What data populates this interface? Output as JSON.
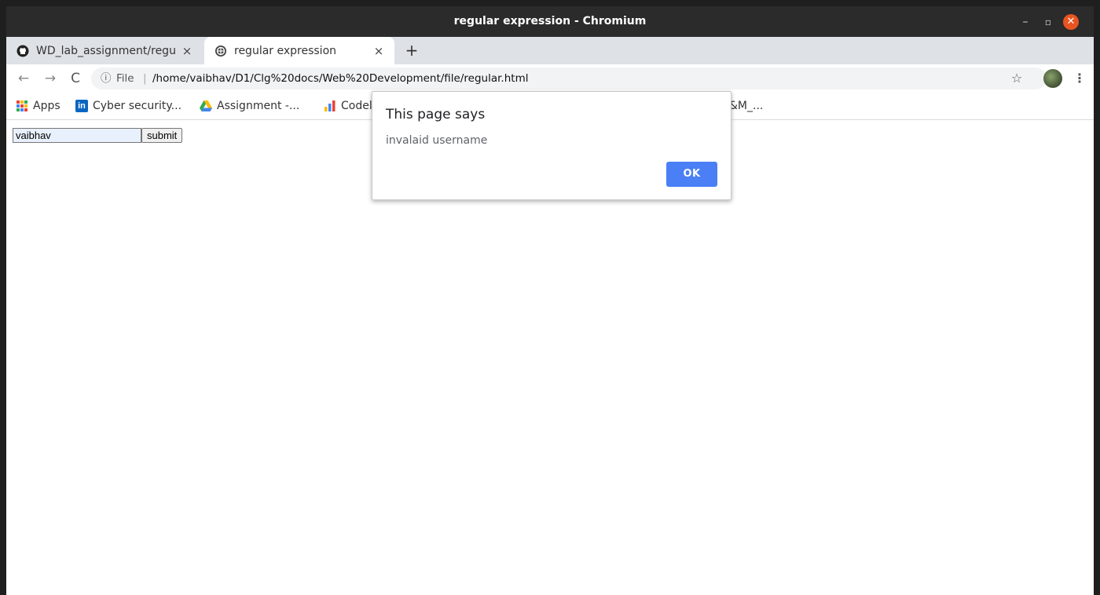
{
  "window": {
    "title": "regular expression - Chromium",
    "controls": {
      "minimize": "–",
      "maximize": "▫",
      "close": "✕"
    }
  },
  "tabs": [
    {
      "label": "WD_lab_assignment/regu",
      "icon": "github-icon",
      "close": "×",
      "active": false
    },
    {
      "label": "regular expression",
      "icon": "globe-icon",
      "close": "×",
      "active": true
    }
  ],
  "new_tab": "+",
  "toolbar": {
    "back": "←",
    "forward": "→",
    "reload": "C",
    "info": "ⓘ",
    "scheme": "File",
    "separator": "|",
    "url": "/home/vaibhav/D1/Clg%20docs/Web%20Development/file/regular.html",
    "star": "☆",
    "menu": "⋮"
  },
  "bookmarks": [
    {
      "label": "Apps",
      "icon": "apps-grid-icon"
    },
    {
      "label": "Cyber security...",
      "icon": "linkedin-icon"
    },
    {
      "label": "Assignment -...",
      "icon": "google-drive-icon"
    },
    {
      "label": "Codel",
      "icon": "bar-chart-icon"
    },
    {
      "label": "&M_...",
      "icon": ""
    }
  ],
  "page": {
    "username_value": "vaibhav",
    "submit_label": "submit"
  },
  "dialog": {
    "title": "This page says",
    "message": "invalaid username",
    "ok_label": "OK"
  },
  "colors": {
    "titlebar": "#2b2b2b",
    "close_button": "#e95420",
    "ok_button": "#4a7ff5",
    "linkedin": "#0a66c2"
  }
}
